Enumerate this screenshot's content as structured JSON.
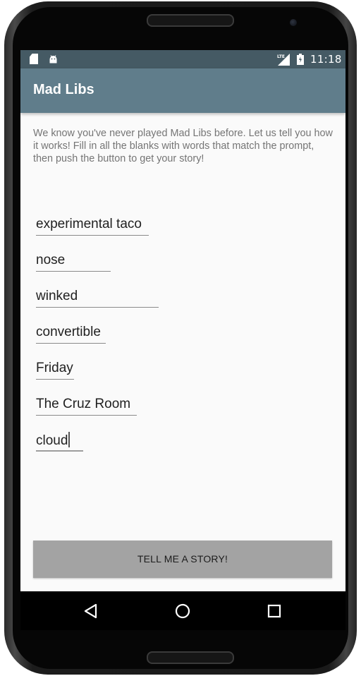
{
  "status_bar": {
    "time": "11:18",
    "icons": [
      "sd-card-icon",
      "android-icon",
      "lte-signal-icon",
      "battery-icon"
    ]
  },
  "app_bar": {
    "title": "Mad Libs",
    "color": "#607d8b",
    "status_color": "#455a64"
  },
  "intro_text": "We know you've never played Mad Libs before. Let us tell you how it works! Fill in all the blanks with words that match the prompt, then push the button to get your story!",
  "fields": [
    {
      "value": "experimental taco"
    },
    {
      "value": "nose"
    },
    {
      "value": "winked"
    },
    {
      "value": "convertible"
    },
    {
      "value": "Friday"
    },
    {
      "value": "The Cruz Room"
    },
    {
      "value": "cloud",
      "focused": true
    }
  ],
  "button": {
    "label": "TELL ME A STORY!"
  },
  "nav_bar": {
    "icons": [
      "back-icon",
      "home-icon",
      "recents-icon"
    ]
  }
}
